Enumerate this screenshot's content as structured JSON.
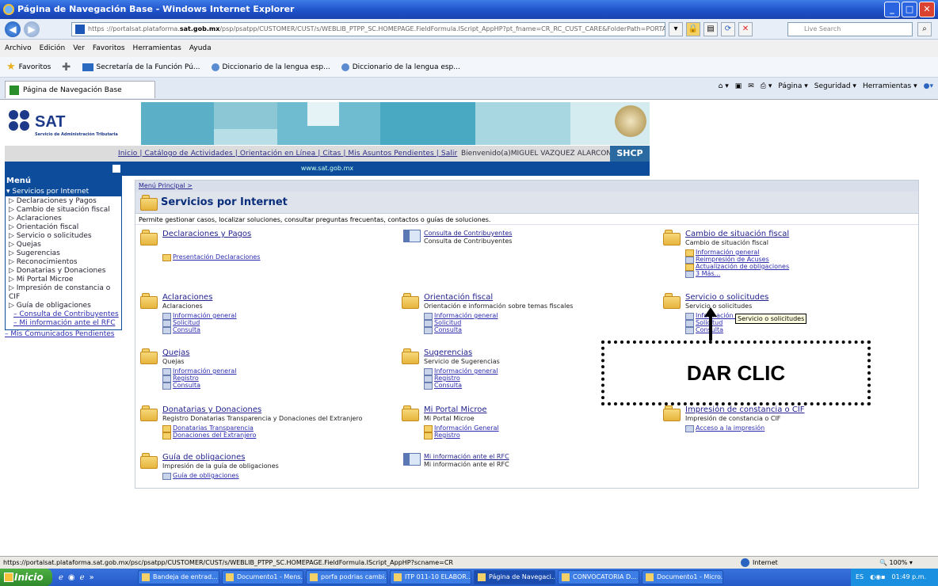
{
  "window": {
    "title": "Página de Navegación Base - Windows Internet Explorer"
  },
  "address": {
    "url_prefix": "https ://portalsat.plataforma.",
    "url_domain": "sat.gob.mx",
    "url_rest": "/psp/psatpp/CUSTOMER/CUST/s/WEBLIB_PTPP_SC.HOMEPAGE.FieldFormula.IScript_AppHP?pt_fname=CR_RC_CUST_CARE&FolderPath=PORTA",
    "search_placeholder": "Live Search"
  },
  "menubar": [
    "Archivo",
    "Edición",
    "Ver",
    "Favoritos",
    "Herramientas",
    "Ayuda"
  ],
  "favorites": {
    "label": "Favoritos",
    "items": [
      "Secretaría de la Función Pú...",
      "Diccionario de la lengua esp...",
      "Diccionario de la lengua esp..."
    ]
  },
  "tab": {
    "label": "Página de Navegación Base"
  },
  "commands": [
    "Página ▾",
    "Seguridad ▾",
    "Herramientas ▾"
  ],
  "header": {
    "logo": "SAT",
    "logo_sub": "Servicio de Administración Tributaria",
    "nav": "Inicio | Catálogo de Actividades | Orientación en Línea | Citas | Mis Asuntos Pendientes | Salir",
    "welcome": "Bienvenido(a)MIGUEL VAZQUEZ ALARCON",
    "shcp": "SHCP",
    "site": "www.sat.gob.mx"
  },
  "sidebar": {
    "title": "Menú",
    "section": "Servicios por Internet",
    "items": [
      "▷ Declaraciones y Pagos",
      "▷ Cambio de situación fiscal",
      "▷ Aclaraciones",
      "▷ Orientación fiscal",
      "▷ Servicio o solicitudes",
      "▷ Quejas",
      "▷ Sugerencias",
      "▷ Reconocimientos",
      "▷ Donatarias y Donaciones",
      "▷ Mi Portal Microe",
      "▷ Impresión de constancia o CIF",
      "▷ Guía de obligaciones"
    ],
    "links": [
      "Consulta de Contribuyentes",
      "Mi información ante el RFC"
    ],
    "extra": "Mis Comunicados Pendientes"
  },
  "content": {
    "breadcrumb": "Menú Principal >",
    "title": "Servicios por Internet",
    "desc": "Permite gestionar casos, localizar soluciones, consultar preguntas frecuentas, contactos o guías de soluciones.",
    "cells": [
      {
        "title": "Declaraciones y Pagos",
        "sub": "",
        "links": [
          "Presentación Declaraciones"
        ]
      },
      {
        "title": "Consulta de Contribuyentes",
        "sub": "Consulta de Contribuyentes",
        "links": []
      },
      {
        "title": "Cambio de situación fiscal",
        "sub": "Cambio de situación fiscal",
        "links": [
          "Información general",
          "Reimpresión de Acuses",
          "Actualización de obligaciones",
          "3 Más..."
        ]
      },
      {
        "title": "Aclaraciones",
        "sub": "Aclaraciones",
        "links": [
          "Información general",
          "Solicitud",
          "Consulta"
        ]
      },
      {
        "title": "Orientación fiscal",
        "sub": "Orientación e información sobre temas fiscales",
        "links": [
          "Información general",
          "Solicitud",
          "Consulta"
        ]
      },
      {
        "title": "Servicio o solicitudes",
        "sub": "Servicio o solicitudes",
        "links": [
          "Información g",
          "Solicitud",
          "Consulta"
        ]
      },
      {
        "title": "Quejas",
        "sub": "Quejas",
        "links": [
          "Información general",
          "Registro",
          "Consulta"
        ]
      },
      {
        "title": "Sugerencias",
        "sub": "Servicio de Sugerencias",
        "links": [
          "Información general",
          "Registro",
          "Consulta"
        ]
      },
      {
        "title": "Donatarias y Donaciones",
        "sub": "Registro Donatarias Transparencia y Donaciones del Extranjero",
        "links": [
          "Donatarias Transparencia",
          "Donaciones del Extranjero"
        ]
      },
      {
        "title": "Mi Portal Microe",
        "sub": "Mi Portal Microe",
        "links": [
          "Información General",
          "Registro"
        ]
      },
      {
        "title": "Impresión de constancia o CIF",
        "sub": "Impresión de constancia o CIF",
        "links": [
          "Acceso a la impresión"
        ]
      },
      {
        "title": "Guía de obligaciones",
        "sub": "Impresión de la guía de obligaciones",
        "links": [
          "Guía de obligaciones"
        ]
      },
      {
        "title": "Mi información ante el RFC",
        "sub": "Mi información ante el RFC",
        "links": []
      }
    ]
  },
  "tooltip": "Servicio o solicitudes",
  "callout": "DAR CLIC",
  "status": {
    "url": "https://portalsat.plataforma.sat.gob.mx/psc/psatpp/CUSTOMER/CUST/s/WEBLIB_PTPP_SC.HOMEPAGE.FieldFormula.IScript_AppHP?scname=CR",
    "zone": "Internet",
    "zoom": "100%"
  },
  "taskbar": {
    "start": "Inicio",
    "tasks": [
      "Bandeja de entrad...",
      "Documento1 - Mens...",
      "porfa podrias cambi...",
      "ITP 011-10 ELABOR...",
      "Página de Navegaci...",
      "CONVOCATORIA D...",
      "Documento1 - Micro..."
    ],
    "lang": "ES",
    "time": "01:49 p.m."
  }
}
